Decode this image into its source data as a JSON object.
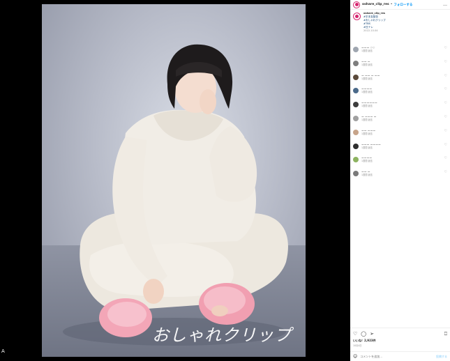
{
  "header": {
    "username": "oshare_clip_res",
    "follow_label": "フォローする",
    "more": "…"
  },
  "caption": {
    "username": "oshare_clip_res",
    "lines": [
      "#平手友梨奈",
      "#おしゃれクリップ",
      "#TBS",
      "#日テレ"
    ],
    "time": "2022.10.04"
  },
  "photo": {
    "signature": "おしゃれクリップ",
    "corner_mark": "A"
  },
  "comments": [
    {
      "text": "ーーー  ♡♡",
      "meta": "1週間  返信",
      "color": "#9fa6b0"
    },
    {
      "text": "ーー  ー",
      "meta": "1週間  返信",
      "color": "#7d7d7d"
    },
    {
      "text": "ー ーー ー ーー",
      "meta": "1週間  返信",
      "color": "#5b4a3b"
    },
    {
      "text": "ーーーー",
      "meta": "1週間  返信",
      "color": "#4b6a8a"
    },
    {
      "text": "ーーーーーー",
      "meta": "1週間  返信",
      "color": "#3c3c3c"
    },
    {
      "text": "ー ーーー ー",
      "meta": "1週間  返信",
      "color": "#a0a0a0"
    },
    {
      "text": "ーー ーーー",
      "meta": "1週間  返信",
      "color": "#c7a48a"
    },
    {
      "text": "ーーー ーーーー",
      "meta": "1週間  返信",
      "color": "#2e2e2e"
    },
    {
      "text": "ーーーー",
      "meta": "1週間  返信",
      "color": "#8db360"
    },
    {
      "text": "ーー ー",
      "meta": "1週間  返信",
      "color": "#7a7a7a"
    }
  ],
  "actions": {
    "like_icon": "heart-icon",
    "comment_icon": "comment-icon",
    "share_icon": "share-icon",
    "save_icon": "bookmark-icon",
    "likes": "いいね！2,923件",
    "date": "10月4日"
  },
  "comment_box": {
    "placeholder": "コメントを追加...",
    "post_label": "投稿する"
  }
}
